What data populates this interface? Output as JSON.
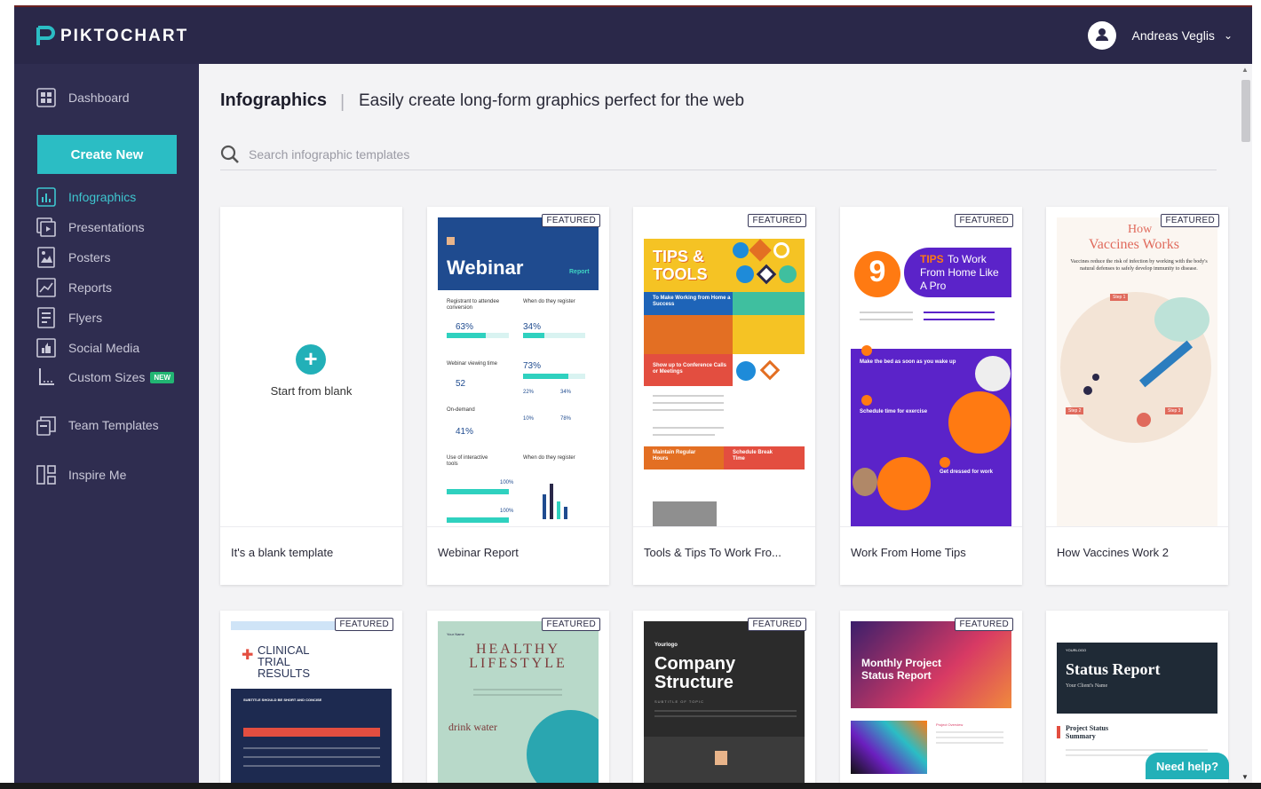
{
  "header": {
    "logo_text": "PIKTOCHART",
    "user_name": "Andreas Veglis",
    "caret": "⌄"
  },
  "sidebar": {
    "dashboard": "Dashboard",
    "create_new": "Create New",
    "items": [
      {
        "label": "Infographics",
        "icon": "infographic-icon",
        "active": true
      },
      {
        "label": "Presentations",
        "icon": "presentation-icon"
      },
      {
        "label": "Posters",
        "icon": "poster-icon"
      },
      {
        "label": "Reports",
        "icon": "report-icon"
      },
      {
        "label": "Flyers",
        "icon": "flyer-icon"
      },
      {
        "label": "Social Media",
        "icon": "social-media-icon"
      },
      {
        "label": "Custom Sizes",
        "icon": "custom-size-icon",
        "badge": "NEW"
      }
    ],
    "team_templates": "Team Templates",
    "inspire_me": "Inspire Me"
  },
  "main": {
    "title": "Infographics",
    "separator": "|",
    "subtitle": "Easily create long-form graphics perfect for the web",
    "search_placeholder": "Search infographic templates",
    "featured_label": "FEATURED",
    "blank": {
      "label": "Start from blank",
      "title": "It's a blank template",
      "plus": "+"
    },
    "templates_row1": [
      {
        "title": "Webinar Report"
      },
      {
        "title": "Tools & Tips To Work Fro..."
      },
      {
        "title": "Work From Home Tips"
      },
      {
        "title": "How Vaccines Work 2"
      }
    ]
  },
  "thumbs": {
    "webinar": {
      "heading": "Webinar",
      "tag": "Report",
      "p1": "63%",
      "p2": "34%",
      "p3": "73%",
      "p4": "52",
      "p5": "41%",
      "s1": "Registrant to attendee conversion",
      "s2": "When do they register",
      "s3": "Webinar viewing time",
      "s4": "On-demand",
      "s5": "Use of interactive tools",
      "s6": "When do they register",
      "p6": "100%",
      "p7": "100%",
      "p8": "22%",
      "p9": "34%",
      "p10": "10%",
      "p11": "78%"
    },
    "tips": {
      "h1": "TIPS &",
      "h2": "TOOLS",
      "b1": "To Make Working from Home a Success",
      "b2": "Show up to Conference Calls or Meetings",
      "b3": "Maintain Regular Hours",
      "b4": "Schedule Break Time"
    },
    "wfh": {
      "num": "9",
      "h1": "TIPS",
      "h2": "To Work From Home Like A Pro",
      "s1": "Make the bed as soon as you wake up",
      "s2": "Schedule time for exercise",
      "s3": "Get dressed for work"
    },
    "vaccine": {
      "h1": "How",
      "h2": "Vaccines Works",
      "sub": "Vaccines reduce the risk of infection by working with the body's natural defenses to safely develop immunity to disease.",
      "step1": "Step 1",
      "step2": "Step 2",
      "step3": "Step 3"
    },
    "clinical": {
      "h1": "CLINICAL",
      "h2": "TRIAL",
      "h3": "RESULTS",
      "sub": "SUBTITLE SHOULD BE SHORT AND CONCISE"
    },
    "healthy": {
      "h1": "HEALTHY",
      "h2": "LIFESTYLE",
      "sub": "drink water",
      "top": "Your Name"
    },
    "company": {
      "logo": "Yourlogo",
      "h1": "Company",
      "h2": "Structure",
      "sub": "SUBTITLE OF TOPIC"
    },
    "monthly": {
      "h1": "Monthly Project",
      "h2": "Status Report",
      "sec": "Project Overview"
    },
    "status": {
      "logo": "YOURLOGO",
      "h1": "Status Report",
      "sub": "Your Client's Name",
      "sec1": "Project Status",
      "sec2": "Summary"
    }
  },
  "help": {
    "label": "Need help?"
  },
  "colors": {
    "header_bg": "#2a2849",
    "sidebar_bg": "#2f2d50",
    "accent": "#2bbdc4",
    "content_bg": "#f3f3f5"
  }
}
